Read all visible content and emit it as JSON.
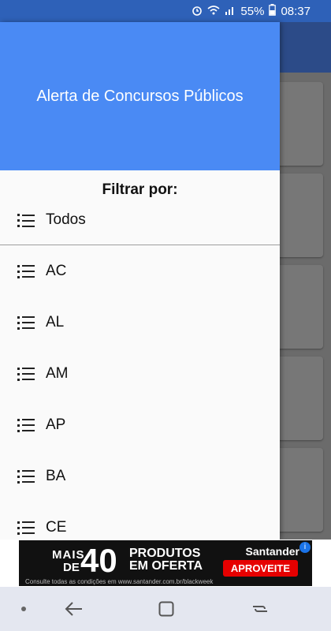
{
  "status_bar": {
    "battery": "55%",
    "time": "08:37"
  },
  "drawer": {
    "title": "Alerta de Concursos Públicos",
    "filter_title": "Filtrar por:",
    "items": [
      "Todos",
      "AC",
      "AL",
      "AM",
      "AP",
      "BA",
      "CE"
    ]
  },
  "ad": {
    "mais": "MAIS",
    "de": "DE",
    "number": "40",
    "line1": "PRODUTOS",
    "line2": "EM OFERTA",
    "brand": "Santander",
    "cta": "APROVEITE",
    "fine_print": "Consulte todas as condições em www.santander.com.br/blackweek"
  },
  "colors": {
    "header": "#4a8af4",
    "status_bar": "#2e61b8",
    "nav_bar": "#e4e7f0"
  }
}
